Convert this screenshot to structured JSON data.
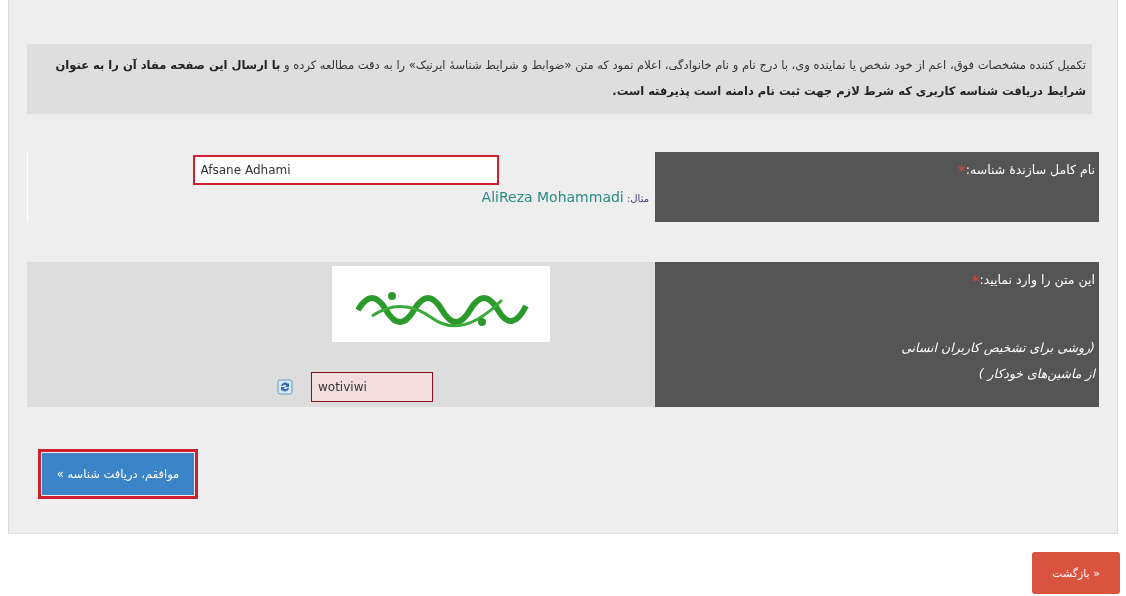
{
  "notice": {
    "text": "تکمیل کننده مشخصات فوق، اعم از خود شخص یا نماینده وی، با درج نام و نام خانوادگی، اعلام نمود که متن «ضوابط و شرایط شناسهٔ ایرنیک» را به دقت مطالعه کرده و **با ارسال این صفحه مفاد آن را به عنوان شرایط دریافت شناسه کاربری که شرط لازم جهت ثبت نام دامنه است پذیرفته است.**"
  },
  "fields": [
    {
      "kind": "name",
      "label": "نام کامل سازندهٔ شناسه:",
      "required_mark": "*",
      "value": "Afsane Adhami",
      "example_label": "مثال:",
      "example": "AliReza Mohammadi",
      "highlighted": true
    },
    {
      "kind": "captcha",
      "label": "این متن را وارد نمایید:",
      "required_mark": "*",
      "hint_lines": [
        "(روشی برای تشخیص کاربران انسانی",
        "از ماشین‌های خودکار )"
      ],
      "value": "wotiviwi"
    }
  ],
  "submit_button": {
    "label": "موافقم، دریافت شناسه »",
    "highlighted": true
  },
  "back_button": {
    "label": "« بازگشت"
  }
}
